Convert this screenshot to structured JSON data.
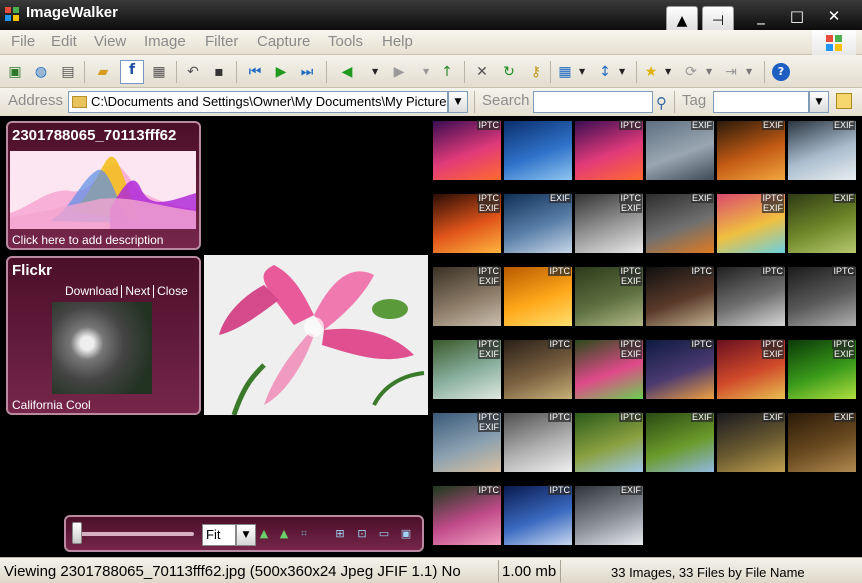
{
  "window": {
    "title": "ImageWalker",
    "pin_icon": "pin-icon",
    "up_icon": "up-arrow-icon"
  },
  "menu": [
    "File",
    "Edit",
    "View",
    "Image",
    "Filter",
    "Capture",
    "Tools",
    "Help"
  ],
  "address": {
    "label": "Address",
    "value": "C:\\Documents and Settings\\Owner\\My Documents\\My Pictures"
  },
  "search": {
    "label": "Search",
    "value": ""
  },
  "tag": {
    "label": "Tag",
    "value": ""
  },
  "info_panel": {
    "title": "2301788065_70113fff62",
    "description": "Click here to add description"
  },
  "flickr": {
    "title": "Flickr",
    "links": [
      "Download",
      "Next",
      "Close"
    ],
    "caption": "California Cool"
  },
  "zoom": {
    "mode": "Fit"
  },
  "thumbnails": [
    {
      "colors": [
        "#3a0d52",
        "#e13a7a",
        "#ff6a2e"
      ],
      "tags": "IPTC"
    },
    {
      "colors": [
        "#0b2f6e",
        "#2f72c9",
        "#8fc6f0"
      ],
      "tags": ""
    },
    {
      "colors": [
        "#3a0d52",
        "#e13a7a",
        "#ff6a2e"
      ],
      "tags": "IPTC"
    },
    {
      "colors": [
        "#5f6f80",
        "#9aa7b2",
        "#3e4a56"
      ],
      "tags": "EXIF"
    },
    {
      "colors": [
        "#2a1a0a",
        "#c25a14",
        "#f3a640"
      ],
      "tags": "EXIF"
    },
    {
      "colors": [
        "#2a3540",
        "#a9bccd",
        "#e9eef2"
      ],
      "tags": "EXIF"
    },
    {
      "colors": [
        "#2a0d05",
        "#e0541a",
        "#ffb540"
      ],
      "tags": "IPTC EXIF"
    },
    {
      "colors": [
        "#0e2f58",
        "#5a7fa8",
        "#c8d7e8"
      ],
      "tags": "EXIF"
    },
    {
      "colors": [
        "#333333",
        "#9a9a9a",
        "#eaeaea"
      ],
      "tags": "IPTC EXIF"
    },
    {
      "colors": [
        "#2d2d2d",
        "#707070",
        "#e07a20"
      ],
      "tags": "EXIF"
    },
    {
      "colors": [
        "#d94a6e",
        "#f0c040",
        "#6ad0e0"
      ],
      "tags": "IPTC EXIF"
    },
    {
      "colors": [
        "#2f3a14",
        "#6f8a2a",
        "#b8c870"
      ],
      "tags": "EXIF"
    },
    {
      "colors": [
        "#3a3025",
        "#8a7a66",
        "#cbbfae"
      ],
      "tags": "IPTC EXIF"
    },
    {
      "colors": [
        "#b85a00",
        "#ffa81a",
        "#ffe070"
      ],
      "tags": "IPTC"
    },
    {
      "colors": [
        "#2c3a1a",
        "#5d7040",
        "#b4b888"
      ],
      "tags": "IPTC EXIF"
    },
    {
      "colors": [
        "#101010",
        "#5a3a2a",
        "#c0b090"
      ],
      "tags": "IPTC"
    },
    {
      "colors": [
        "#202020",
        "#707070",
        "#d8d8d8"
      ],
      "tags": "IPTC"
    },
    {
      "colors": [
        "#1a1a1a",
        "#5a5a5a",
        "#b0b0b0"
      ],
      "tags": "IPTC"
    },
    {
      "colors": [
        "#3a5a2a",
        "#8ab0a0",
        "#e0e8e0"
      ],
      "tags": "IPTC EXIF"
    },
    {
      "colors": [
        "#2a2018",
        "#7a6040",
        "#c8b078"
      ],
      "tags": "IPTC"
    },
    {
      "colors": [
        "#2a4a1a",
        "#e04a8a",
        "#6ad050"
      ],
      "tags": "IPTC EXIF"
    },
    {
      "colors": [
        "#0e1a40",
        "#4a3a70",
        "#f0a040"
      ],
      "tags": "IPTC"
    },
    {
      "colors": [
        "#6a1020",
        "#d04a2a",
        "#e8c050"
      ],
      "tags": "IPTC EXIF"
    },
    {
      "colors": [
        "#0a3a08",
        "#3a9a1a",
        "#b0e040"
      ],
      "tags": "IPTC EXIF"
    },
    {
      "colors": [
        "#3a5a7a",
        "#8aa0b0",
        "#d8c0a0"
      ],
      "tags": "IPTC EXIF"
    },
    {
      "colors": [
        "#505050",
        "#b0b0b0",
        "#f0f0f0"
      ],
      "tags": "IPTC"
    },
    {
      "colors": [
        "#2a5a1a",
        "#8aa040",
        "#a0c8e8"
      ],
      "tags": "IPTC"
    },
    {
      "colors": [
        "#2a4a14",
        "#6a9a2a",
        "#90b8e0"
      ],
      "tags": "EXIF"
    },
    {
      "colors": [
        "#1a1a20",
        "#6a5a30",
        "#c0a050"
      ],
      "tags": "EXIF"
    },
    {
      "colors": [
        "#2a1a08",
        "#6a4a20",
        "#b08a50"
      ],
      "tags": "EXIF"
    },
    {
      "colors": [
        "#1a3a1a",
        "#c04a8a",
        "#f0a0c0"
      ],
      "tags": "IPTC"
    },
    {
      "colors": [
        "#0a1a50",
        "#3a6ac0",
        "#c8d8f0"
      ],
      "tags": "IPTC"
    },
    {
      "colors": [
        "#30343a",
        "#8a9098",
        "#e8eaee"
      ],
      "tags": "EXIF"
    }
  ],
  "status": {
    "viewing": "Viewing 2301788065_70113fff62.jpg (500x360x24 Jpeg JFIF 1.1) No",
    "size": "1.00 mb",
    "summary": "33 Images, 33 Files by File Name"
  }
}
